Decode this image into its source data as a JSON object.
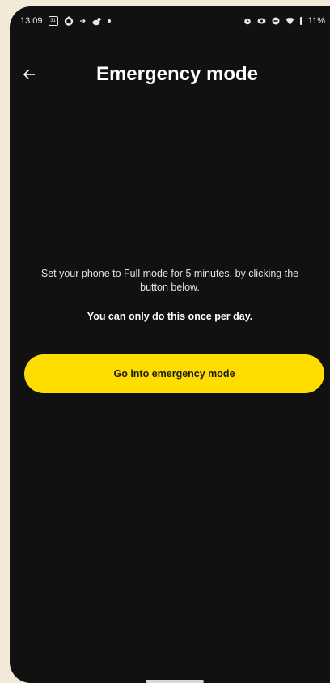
{
  "status_bar": {
    "time": "13:09",
    "calendar_day": "31",
    "battery": "11%",
    "icons_left": [
      "calendar-icon",
      "app-o-icon",
      "arrow-icon",
      "bird-icon",
      "dot-icon"
    ],
    "icons_right": [
      "alarm-icon",
      "eye-icon",
      "do-not-disturb-icon",
      "wifi-icon",
      "battery-icon"
    ]
  },
  "header": {
    "title": "Emergency mode",
    "back_icon": "arrow-left-icon"
  },
  "main": {
    "description": "Set your phone to Full mode for 5 minutes, by clicking the button below.",
    "notice": "You can only do this once per day.",
    "button_label": "Go into emergency mode"
  },
  "colors": {
    "background": "#111111",
    "accent": "#ffdd00",
    "text": "#ffffff"
  }
}
